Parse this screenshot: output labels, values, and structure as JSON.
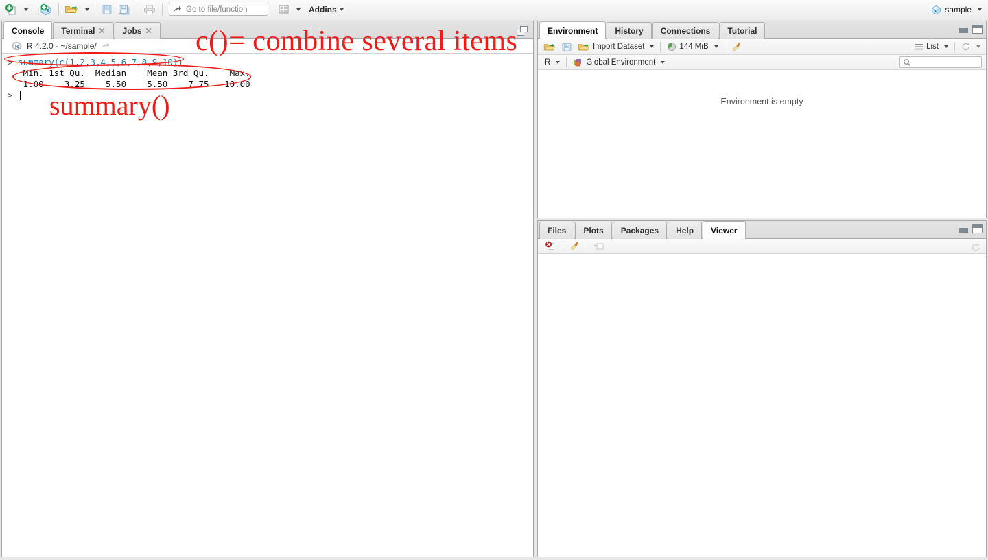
{
  "toolbar": {
    "buttons": [
      {
        "name": "new-file",
        "icon": "new-file-icon",
        "has_caret": true
      },
      {
        "name": "new-project",
        "icon": "new-project-icon",
        "has_caret": false
      },
      {
        "name": "open-file",
        "icon": "open-folder-icon",
        "has_caret": true
      },
      {
        "name": "save",
        "icon": "save-icon",
        "has_caret": false
      },
      {
        "name": "save-all",
        "icon": "save-all-icon",
        "has_caret": false
      },
      {
        "name": "print",
        "icon": "print-icon",
        "has_caret": false
      }
    ],
    "goto": {
      "placeholder": "Go to file/function"
    },
    "panes_icon": "panes-layout-icon",
    "addins_label": "Addins",
    "project_name": "sample",
    "project_icon": "r-project-icon"
  },
  "console": {
    "tabs": [
      {
        "label": "Console",
        "active": true,
        "closeable": false
      },
      {
        "label": "Terminal",
        "active": false,
        "closeable": true
      },
      {
        "label": "Jobs",
        "active": false,
        "closeable": true
      }
    ],
    "popout_icon": "popout-console-icon",
    "header": {
      "r_icon": "r-logo-icon",
      "version_line": "R 4.2.0  ·  ~/sample/",
      "arrow_icon": "go-to-directory-icon"
    },
    "lines": [
      {
        "type": "input",
        "prompt": "> ",
        "text": "summary(c(1,2,3,4,5,6,7,8,9,10))"
      },
      {
        "type": "output",
        "prompt": "",
        "text": "   Min. 1st Qu.  Median    Mean 3rd Qu.    Max. "
      },
      {
        "type": "output",
        "prompt": "",
        "text": "   1.00    3.25    5.50    5.50    7.75   10.00 "
      },
      {
        "type": "prompt",
        "prompt": "> ",
        "text": ""
      }
    ]
  },
  "annotations": {
    "combine": "c()= combine several items",
    "summary": "summary()",
    "color": "#ee1b16"
  },
  "environment": {
    "tabs": [
      {
        "label": "Environment",
        "active": true
      },
      {
        "label": "History",
        "active": false
      },
      {
        "label": "Connections",
        "active": false
      },
      {
        "label": "Tutorial",
        "active": false
      }
    ],
    "toolbar": {
      "open_icon": "open-workspace-icon",
      "save_icon": "save-workspace-icon",
      "import_icon": "import-dataset-icon",
      "import_label": "Import Dataset",
      "memory_icon": "memory-pie-icon",
      "memory_label": "144 MiB",
      "broom_icon": "clear-workspace-icon",
      "list_icon": "list-view-icon",
      "list_label": "List",
      "refresh_icon": "refresh-icon"
    },
    "scope": {
      "language_label": "R",
      "globalenv_icon": "globalenv-icon",
      "globalenv_label": "Global Environment"
    },
    "search": {
      "placeholder": "",
      "value": "",
      "icon": "search-icon"
    },
    "empty_message": "Environment is empty",
    "min_icon": "minimize-icon",
    "max_icon": "maximize-icon"
  },
  "viewer": {
    "tabs": [
      {
        "label": "Files",
        "active": false
      },
      {
        "label": "Plots",
        "active": false
      },
      {
        "label": "Packages",
        "active": false
      },
      {
        "label": "Help",
        "active": false
      },
      {
        "label": "Viewer",
        "active": true
      }
    ],
    "toolbar": {
      "stop_icon": "stop-icon",
      "broom_icon": "clear-viewer-icon",
      "popout_icon": "show-in-new-window-icon",
      "refresh_icon": "refresh-viewer-icon"
    },
    "min_icon": "minimize-icon",
    "max_icon": "maximize-icon"
  },
  "colors": {
    "accent_red": "#ee1b16",
    "console_command": "#137eb0",
    "pane_border": "#a9a9a9",
    "toolbar_bg": "#ededed"
  }
}
